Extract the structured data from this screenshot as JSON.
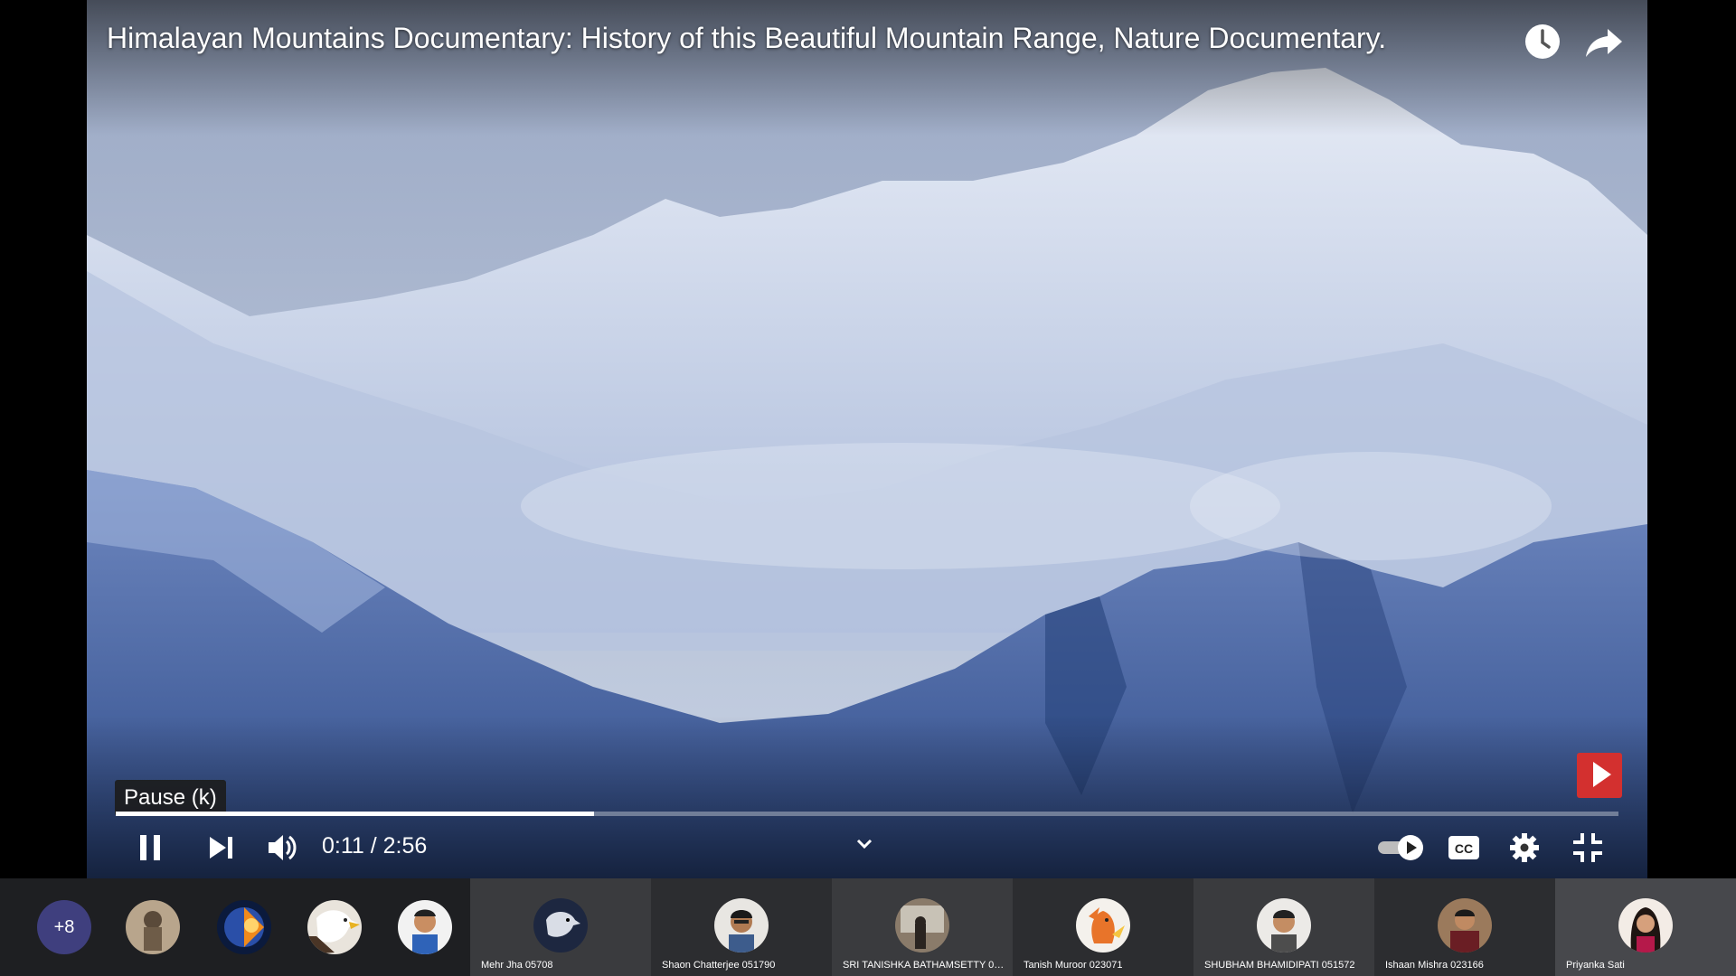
{
  "video": {
    "title": "Himalayan Mountains Documentary: History of this Beautiful Mountain Range, Nature Documentary.",
    "tooltip": "Pause (k)",
    "time": "0:11 / 2:56",
    "progress_fraction": 0.318,
    "icons": [
      "watch-later-icon",
      "share-icon",
      "pause-icon",
      "next-icon",
      "volume-icon",
      "chevron-down-icon",
      "autoplay-toggle-icon",
      "captions-icon",
      "settings-icon",
      "exit-fullscreen-icon",
      "subscribe-icon"
    ],
    "subscribe_color": "#d3302f"
  },
  "participants": {
    "more_label": "+8",
    "tiles": [
      {
        "name": "Mehr  Jha 05708"
      },
      {
        "name": "Shaon Chatterjee  051790"
      },
      {
        "name": "SRI TANISHKA   BATHAMSETTY 0515..."
      },
      {
        "name": "Tanish  Muroor 023071"
      },
      {
        "name": "SHUBHAM  BHAMIDIPATI 051572"
      },
      {
        "name": "Ishaan  Mishra 023166"
      },
      {
        "name": "Priyanka Sati"
      }
    ]
  }
}
